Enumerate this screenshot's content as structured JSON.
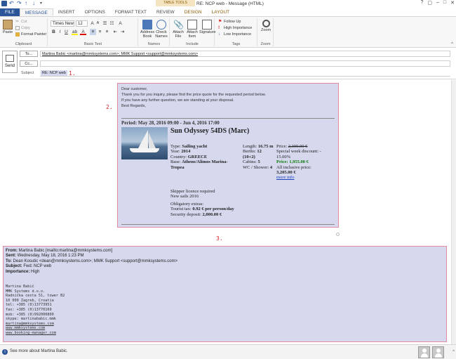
{
  "window": {
    "title": "RE: NCP web - Message (HTML)",
    "contextual_tab_group": "TABLE TOOLS",
    "controls": [
      "?",
      "▢",
      "–",
      "□",
      "✕"
    ]
  },
  "tabs": [
    "FILE",
    "MESSAGE",
    "INSERT",
    "OPTIONS",
    "FORMAT TEXT",
    "REVIEW",
    "DESIGN",
    "LAYOUT"
  ],
  "ribbon": {
    "clipboard": {
      "paste": "Paste",
      "cut": "Cut",
      "copy": "Copy",
      "format_painter": "Format Painter",
      "label": "Clipboard"
    },
    "basic_text": {
      "font": "Times New",
      "size": "12",
      "label": "Basic Text"
    },
    "names": {
      "address_book": "Address Book",
      "check_names": "Check Names",
      "label": "Names"
    },
    "include": {
      "attach_file": "Attach File",
      "attach_item": "Attach Item",
      "signature": "Signature",
      "label": "Include"
    },
    "tags": {
      "follow_up": "Follow Up",
      "high_importance": "High Importance",
      "low_importance": "Low Importance",
      "label": "Tags"
    },
    "zoom": {
      "zoom": "Zoom",
      "label": "Zoom"
    }
  },
  "header": {
    "send": "Send",
    "to_button": "To...",
    "cc_button": "Cc...",
    "to_value": "Martina Babic <martina@mmksystems.com>; MMK Support <support@mmksystems.com>",
    "cc_value": "",
    "bcc_value": "",
    "subject_label": "Subject",
    "subject_value": "RE: NCP web"
  },
  "annotations": {
    "one": "1.",
    "two": "2.",
    "three": "3."
  },
  "quote": {
    "intro": [
      "Dear customer,",
      "Thank you for you inquiry, please find the price quote for the requested period below.",
      "If you have any further question, we are standing at your disposal.",
      "Best Regards,"
    ],
    "period": "Period: May 28, 2016 09:00 - Jun 4, 2016 17:00",
    "boat_name": "Sun Odyssey 54DS (Marc)",
    "type_label": "Type:",
    "type_value": "Sailing yacht",
    "year_label": "Year:",
    "year_value": "2014",
    "country_label": "Country:",
    "country_value": "GREECE",
    "base_label": "Base:",
    "base_value": "Athens/Alimos Marina-Tropea",
    "length_label": "Length:",
    "length_value": "16.75 m",
    "berths_label": "Berths:",
    "berths_value": "12 (10+2)",
    "cabins_label": "Cabins:",
    "cabins_value": "5",
    "wc_label": "WC / Shower:",
    "wc_value": "4",
    "price_label": "Price:",
    "price_value": "2,300.00 €",
    "discount": "Special week discount: - 15.00%",
    "final_price": "Price: 1,955.00 €",
    "all_inclusive_label": "All inclusive price:",
    "all_inclusive_value": "3,205.00 €",
    "more_info": "more info",
    "skipper": "Skipper licence required",
    "new_sails": "New sails 2016",
    "obligatory": "Obligatory extras:",
    "tourist_tax_label": "Tourist tax:",
    "tourist_tax_value": "0.92 € per person/day",
    "deposit_label": "Security deposit:",
    "deposit_value": "2,000.00 €"
  },
  "forward": {
    "from_label": "From:",
    "from_value": " Martina Babic [mailto:martina@mmksystems.com]",
    "sent_label": "Sent:",
    "sent_value": " Wednesday, May 18, 2016 1:23 PM",
    "to_label": "To:",
    "to_value": " Dean Kosutic <dean@mmksystems.com>; MMK Support <support@mmksystems.com>",
    "subject_label": "Subject:",
    "subject_value": " Fwd: NCP web",
    "importance_label": "Importance:",
    "importance_value": " High",
    "signature": [
      "Martina Babić",
      "MMK Systems d.o.o.",
      "Radnička cesta 51, tower B2",
      "10 000 Zagreb, Croatia",
      "tel: +385 (0)13773951",
      "fax: +385 (0)13770169",
      "mob: +385 (0)992000800",
      "skype: martinababic.mmk"
    ],
    "links": [
      "martina@mmksystems.com",
      "www.mmksystems.com",
      "www.booking-manager.com"
    ]
  },
  "footer": {
    "see_more": "See more about Martina Babic."
  }
}
